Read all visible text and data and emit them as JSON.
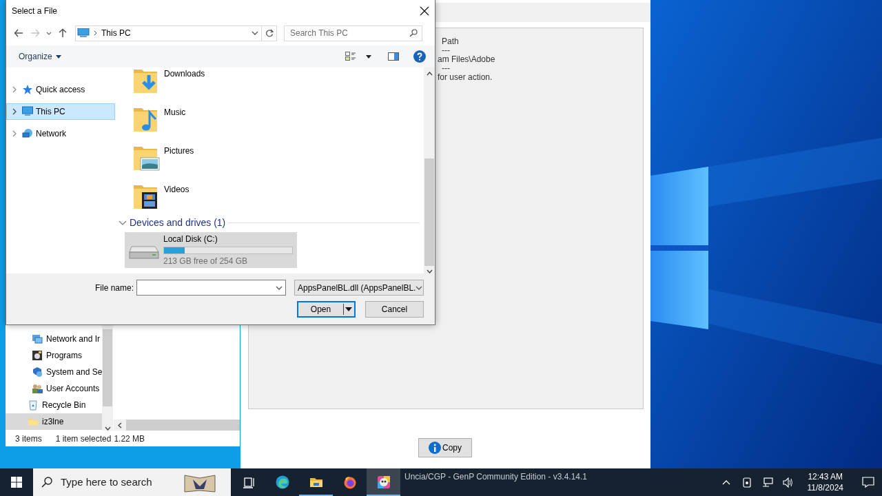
{
  "dialog": {
    "title": "Select a File",
    "breadcrumb": "This PC",
    "search": {
      "placeholder": "Search This PC"
    },
    "organize": "Organize",
    "nav": [
      {
        "label": "Quick access",
        "kind": "star",
        "selected": false
      },
      {
        "label": "This PC",
        "kind": "pc",
        "selected": true
      },
      {
        "label": "Network",
        "kind": "network",
        "selected": false
      }
    ],
    "folders": [
      {
        "label": "Downloads",
        "kind": "downloads"
      },
      {
        "label": "Music",
        "kind": "music"
      },
      {
        "label": "Pictures",
        "kind": "pictures"
      },
      {
        "label": "Videos",
        "kind": "videos"
      }
    ],
    "group": {
      "title": "Devices and drives (1)",
      "expanded": true
    },
    "drives": [
      {
        "label": "Local Disk (C:)",
        "level": 0.16,
        "free": "213 GB free of 254 GB",
        "selected": true
      }
    ],
    "file_name_label": "File name:",
    "file_type": "AppsPanelBL.dll (AppsPanelBL.",
    "buttons": [
      {
        "label": "Open",
        "kind": "split",
        "default": true
      },
      {
        "label": "Cancel",
        "kind": "plain",
        "default": false
      }
    ]
  },
  "explorer": {
    "tree": [
      {
        "label": "Network and Ir",
        "kind": "network"
      },
      {
        "label": "Programs",
        "kind": "programs"
      },
      {
        "label": "System and Se",
        "kind": "shield"
      },
      {
        "label": "User Accounts",
        "kind": "users"
      }
    ],
    "nav": [
      {
        "label": "Recycle Bin",
        "kind": "bin",
        "selected": false
      },
      {
        "label": "iz3lne",
        "kind": "folder",
        "selected": true
      }
    ],
    "status": [
      "3 items",
      "1 item selected",
      "1.22 MB"
    ]
  },
  "app": {
    "log": [
      "Path",
      "---",
      "am Files\\Adobe",
      "---",
      "for user action."
    ],
    "copy_button": "Copy",
    "footer": "Uncia/CGP - GenP Community Edition - v3.4.14.1"
  },
  "taskbar": {
    "search": {
      "placeholder": "Type here to search"
    },
    "apps": [
      {
        "kind": "taskview",
        "running": false,
        "selected": false
      },
      {
        "kind": "edge",
        "running": false,
        "selected": false
      },
      {
        "kind": "explorer",
        "running": true,
        "selected": false
      },
      {
        "kind": "firefox",
        "running": false,
        "selected": false
      },
      {
        "kind": "genp",
        "running": true,
        "selected": true
      }
    ],
    "time": "12:43 AM",
    "date": "11/8/2024"
  }
}
